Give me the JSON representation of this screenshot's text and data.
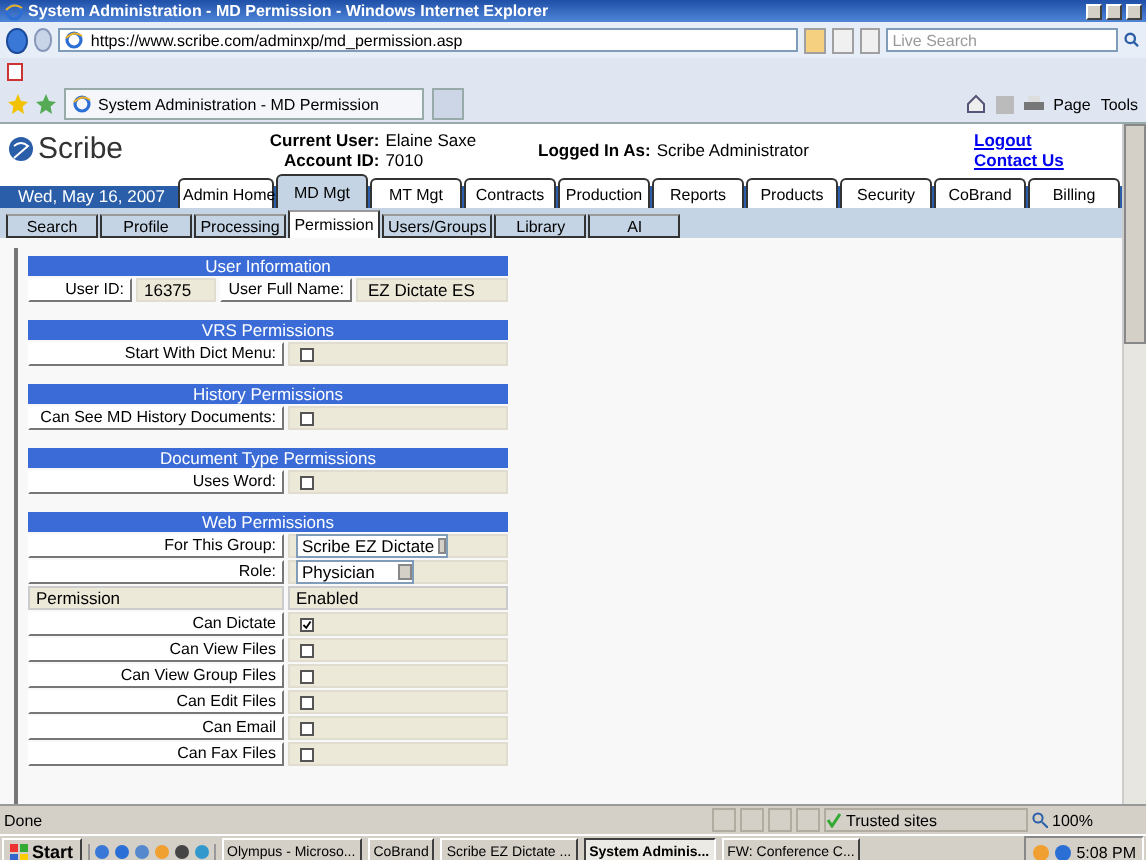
{
  "window": {
    "title": "System Administration - MD Permission - Windows Internet Explorer"
  },
  "address_bar": {
    "url": "https://www.scribe.com/adminxp/md_permission.asp"
  },
  "search": {
    "placeholder": "Live Search"
  },
  "browser_tab": {
    "title": "System Administration - MD Permission"
  },
  "command_bar": {
    "page_label": "Page",
    "tools_label": "Tools"
  },
  "header": {
    "logo": "Scribe",
    "current_user_label": "Current User:",
    "current_user": "Elaine Saxe",
    "account_label": "Account ID:",
    "account_id": "7010",
    "logged_label": "Logged In As:",
    "logged_as": "Scribe Administrator",
    "links": [
      "Logout",
      "Contact Us"
    ]
  },
  "date": "Wed, May 16, 2007",
  "main_tabs": [
    {
      "label": "Admin Home",
      "selected": false
    },
    {
      "label": "MD Mgt",
      "selected": true
    },
    {
      "label": "MT Mgt",
      "selected": false
    },
    {
      "label": "Contracts",
      "selected": false
    },
    {
      "label": "Production",
      "selected": false
    },
    {
      "label": "Reports",
      "selected": false
    },
    {
      "label": "Products",
      "selected": false
    },
    {
      "label": "Security",
      "selected": false
    },
    {
      "label": "CoBrand",
      "selected": false
    },
    {
      "label": "Billing",
      "selected": false
    }
  ],
  "sub_tabs": [
    {
      "label": "Search",
      "selected": false
    },
    {
      "label": "Profile",
      "selected": false
    },
    {
      "label": "Processing",
      "selected": false
    },
    {
      "label": "Permission",
      "selected": true
    },
    {
      "label": "Users/Groups",
      "selected": false
    },
    {
      "label": "Library",
      "selected": false
    },
    {
      "label": "AI",
      "selected": false
    }
  ],
  "sections": [
    {
      "title": "User Information",
      "kind": "info",
      "fields": [
        {
          "label": "User ID:",
          "value": "16375"
        },
        {
          "label": "User Full Name:",
          "value": "EZ Dictate ES"
        }
      ]
    },
    {
      "title": "VRS Permissions",
      "kind": "checks",
      "rows": [
        {
          "label": "Start With Dict Menu:",
          "checked": false
        }
      ]
    },
    {
      "title": "History Permissions",
      "kind": "checks",
      "rows": [
        {
          "label": "Can See MD History Documents:",
          "checked": false
        }
      ]
    },
    {
      "title": "Document Type Permissions",
      "kind": "checks",
      "rows": [
        {
          "label": "Uses Word:",
          "checked": false
        }
      ]
    },
    {
      "title": "Web Permissions",
      "kind": "web",
      "selects": [
        {
          "label": "For This Group:",
          "value": "Scribe EZ Dictate"
        },
        {
          "label": "Role:",
          "value": "Physician"
        }
      ],
      "columns": [
        "Permission",
        "Enabled"
      ],
      "rows": [
        {
          "label": "Can Dictate",
          "checked": true
        },
        {
          "label": "Can View Files",
          "checked": false
        },
        {
          "label": "Can View Group Files",
          "checked": false
        },
        {
          "label": "Can Edit Files",
          "checked": false
        },
        {
          "label": "Can Email",
          "checked": false
        },
        {
          "label": "Can Fax Files",
          "checked": false
        }
      ]
    }
  ],
  "status_bar": {
    "text": "Done",
    "zone": "Trusted sites",
    "zoom": "100%"
  },
  "taskbar": {
    "start": "Start",
    "tasks": [
      {
        "label": "Olympus - Microso...",
        "selected": false
      },
      {
        "label": "CoBrand",
        "selected": false
      },
      {
        "label": "Scribe EZ Dictate ...",
        "selected": false
      },
      {
        "label": "System Adminis...",
        "selected": true
      },
      {
        "label": "FW: Conference C...",
        "selected": false
      }
    ],
    "clock": "5:08 PM"
  }
}
